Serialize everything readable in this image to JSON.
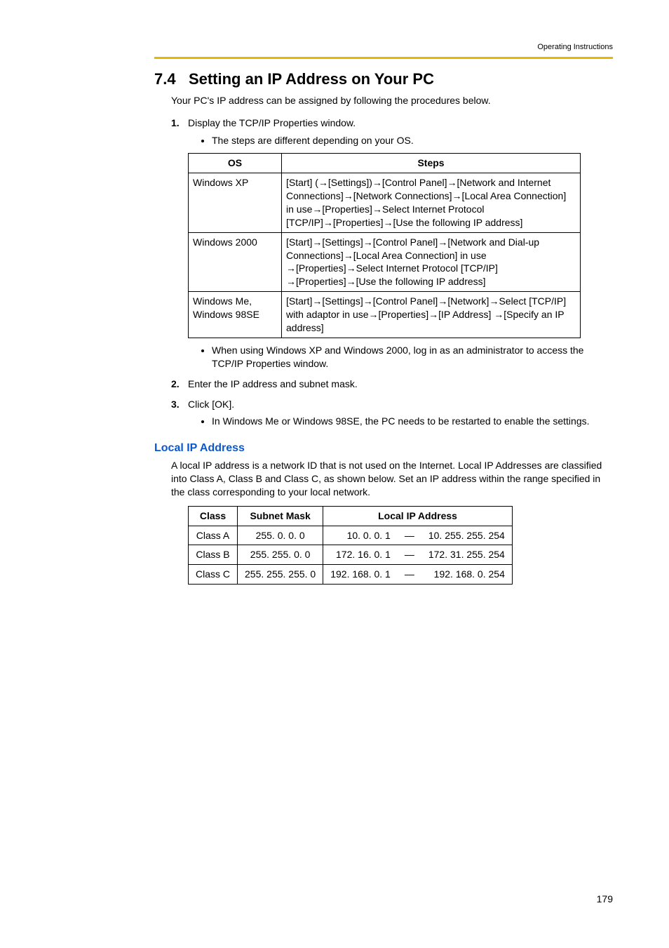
{
  "running_header": "Operating Instructions",
  "section_number": "7.4",
  "section_title": "Setting an IP Address on Your PC",
  "intro": "Your PC's IP address can be assigned by following the procedures below.",
  "step1_num": "1.",
  "step1_text": "Display the TCP/IP Properties window.",
  "step1_bullet": "The steps are different depending on your OS.",
  "os_table": {
    "header_os": "OS",
    "header_steps": "Steps",
    "rows": [
      {
        "os": "Windows XP",
        "steps": "[Start] (→[Settings])→[Control Panel]→[Network and Internet Connections]→[Network Connections]→[Local Area Connection] in use→[Properties]→Select Internet Protocol [TCP/IP]→[Properties]→[Use the following IP address]"
      },
      {
        "os": "Windows 2000",
        "steps": "[Start]→[Settings]→[Control Panel]→[Network and Dial-up Connections]→[Local Area Connection] in use →[Properties]→Select Internet Protocol [TCP/IP] →[Properties]→[Use the following IP address]"
      },
      {
        "os": "Windows Me, Windows 98SE",
        "steps": "[Start]→[Settings]→[Control Panel]→[Network]→Select [TCP/IP] with adaptor in use→[Properties]→[IP Address] →[Specify an IP address]"
      }
    ]
  },
  "step1_bullet2": "When using Windows XP and Windows 2000, log in as an administrator to access the TCP/IP Properties window.",
  "step2_num": "2.",
  "step2_text": "Enter the IP address and subnet mask.",
  "step3_num": "3.",
  "step3_text": "Click [OK].",
  "step3_bullet": "In Windows Me or Windows 98SE, the PC needs to be restarted to enable the settings.",
  "sub_heading": "Local IP Address",
  "sub_intro": "A local IP address is a network ID that is not used on the Internet. Local IP Addresses are classified into Class A, Class B and Class C, as shown below. Set an IP address within the range specified in the class corresponding to your local network.",
  "ip_table": {
    "header_class": "Class",
    "header_mask": "Subnet Mask",
    "header_local": "Local IP Address",
    "sep": "—",
    "rows": [
      {
        "class": "Class A",
        "mask": "255. 0. 0. 0",
        "from": "10. 0. 0. 1",
        "to": "10. 255. 255. 254"
      },
      {
        "class": "Class B",
        "mask": "255. 255. 0. 0",
        "from": "172. 16. 0. 1",
        "to": "172. 31. 255. 254"
      },
      {
        "class": "Class C",
        "mask": "255. 255. 255. 0",
        "from": "192. 168. 0. 1",
        "to": "192. 168. 0. 254"
      }
    ]
  },
  "page_number": "179"
}
